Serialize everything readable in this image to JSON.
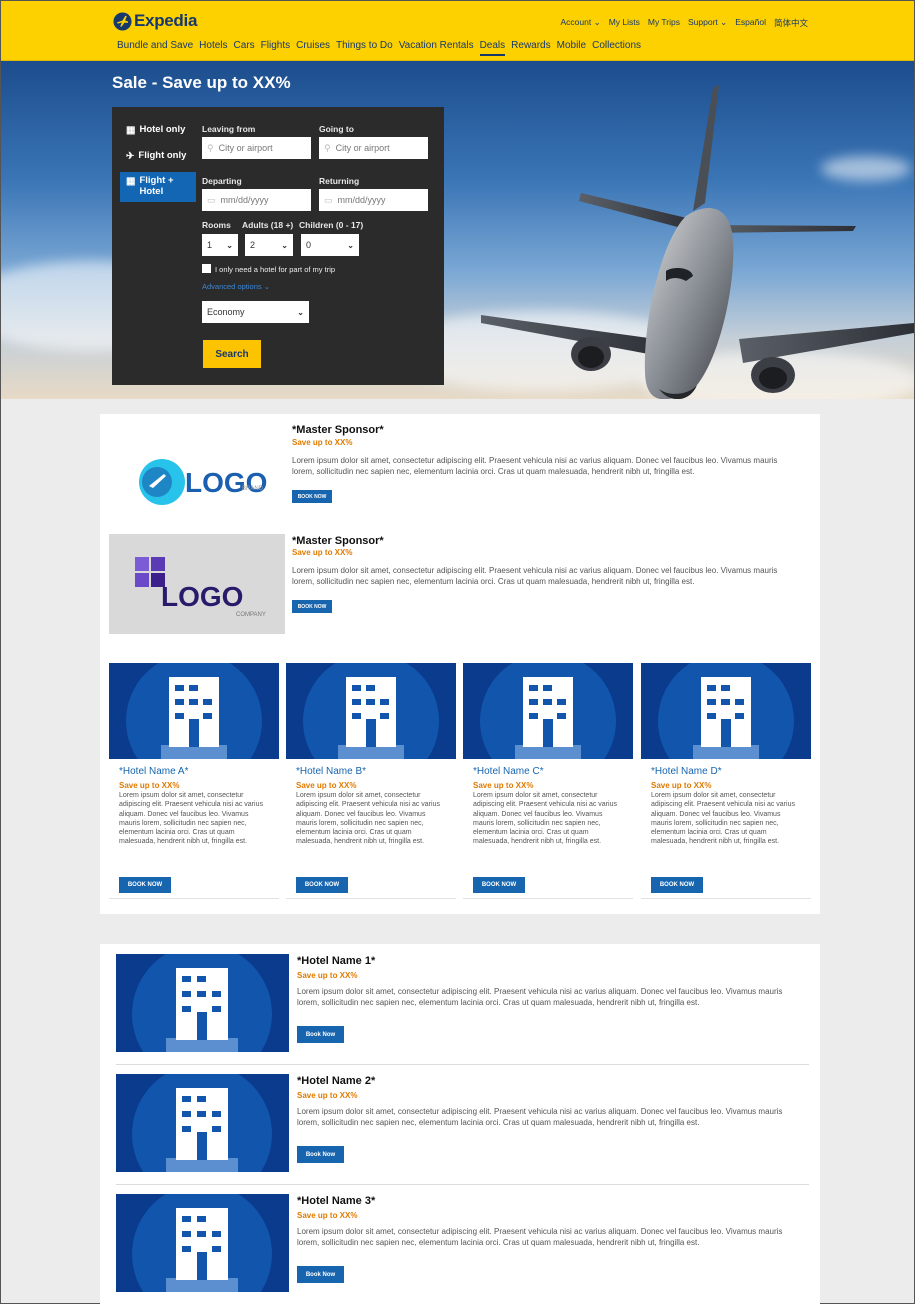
{
  "header": {
    "brand": "Expedia",
    "util_nav": [
      "Account ⌄",
      "My Lists",
      "My Trips",
      "Support ⌄",
      "Español",
      "简体中文"
    ],
    "main_nav": [
      "Bundle and Save",
      "Hotels",
      "Cars",
      "Flights",
      "Cruises",
      "Things to Do",
      "Vacation Rentals",
      "Deals",
      "Rewards",
      "Mobile",
      "Collections"
    ],
    "active_nav": "Deals"
  },
  "hero": {
    "title": "Sale - Save up to XX%"
  },
  "search": {
    "tabs": [
      {
        "label": "Hotel only",
        "icon": "hotel-icon"
      },
      {
        "label": "Flight only",
        "icon": "plane-icon"
      },
      {
        "label": "Flight + Hotel",
        "icon": "flight-hotel-icon"
      }
    ],
    "active_tab": "Flight + Hotel",
    "leaving_label": "Leaving from",
    "leaving_placeholder": "City or airport",
    "going_label": "Going to",
    "going_placeholder": "City or airport",
    "departing_label": "Departing",
    "departing_placeholder": "mm/dd/yyyy",
    "returning_label": "Returning",
    "returning_placeholder": "mm/dd/yyyy",
    "rooms_label": "Rooms",
    "rooms_value": "1",
    "adults_label": "Adults (18 +)",
    "adults_value": "2",
    "children_label": "Children (0 - 17)",
    "children_value": "0",
    "partial_hotel_label": "I only need a hotel for part of my trip",
    "advanced_label": "Advanced options ⌄",
    "class_value": "Economy",
    "search_label": "Search"
  },
  "sponsors": [
    {
      "title": "*Master Sponsor*",
      "save": "Save up to XX%",
      "text": "Lorem ipsum dolor sit amet, consectetur adipiscing elit. Praesent vehicula nisi ac varius aliquam. Donec vel faucibus leo. Vivamus mauris lorem, sollicitudin nec sapien nec, elementum lacinia orci. Cras ut quam malesuada, hendrerit nibh ut, fringilla est.",
      "button": "BOOK NOW",
      "logo_text": "LOGO",
      "logo_sub": "BRAND"
    },
    {
      "title": "*Master Sponsor*",
      "save": "Save up to XX%",
      "text": "Lorem ipsum dolor sit amet, consectetur adipiscing elit. Praesent vehicula nisi ac varius aliquam. Donec vel faucibus leo. Vivamus mauris lorem, sollicitudin nec sapien nec, elementum lacinia orci. Cras ut quam malesuada, hendrerit nibh ut, fringilla est.",
      "button": "BOOK NOW",
      "logo_text": "LOGO",
      "logo_sub": "COMPANY"
    }
  ],
  "hotel_cards": [
    {
      "title": "*Hotel Name A*",
      "save": "Save up to XX%",
      "text": "Lorem ipsum dolor sit amet, consectetur adipiscing elit. Praesent vehicula nisi ac varius aliquam. Donec vel faucibus leo. Vivamus mauris lorem, sollicitudin nec sapien nec, elementum lacinia orci. Cras ut quam malesuada, hendrerit nibh ut, fringilla est.",
      "button": "BOOK NOW"
    },
    {
      "title": "*Hotel Name B*",
      "save": "Save up to XX%",
      "text": "Lorem ipsum dolor sit amet, consectetur adipiscing elit. Praesent vehicula nisi ac varius aliquam. Donec vel faucibus leo. Vivamus mauris lorem, sollicitudin nec sapien nec, elementum lacinia orci. Cras ut quam malesuada, hendrerit nibh ut, fringilla est.",
      "button": "BOOK NOW"
    },
    {
      "title": "*Hotel Name C*",
      "save": "Save up to XX%",
      "text": "Lorem ipsum dolor sit amet, consectetur adipiscing elit. Praesent vehicula nisi ac varius aliquam. Donec vel faucibus leo. Vivamus mauris lorem, sollicitudin nec sapien nec, elementum lacinia orci. Cras ut quam malesuada, hendrerit nibh ut, fringilla est.",
      "button": "BOOK NOW"
    },
    {
      "title": "*Hotel Name D*",
      "save": "Save up to XX%",
      "text": "Lorem ipsum dolor sit amet, consectetur adipiscing elit. Praesent vehicula nisi ac varius aliquam. Donec vel faucibus leo. Vivamus mauris lorem, sollicitudin nec sapien nec, elementum lacinia orci. Cras ut quam malesuada, hendrerit nibh ut, fringilla est.",
      "button": "BOOK NOW"
    }
  ],
  "hotel_list": [
    {
      "title": "*Hotel Name 1*",
      "save": "Save up to XX%",
      "text": "Lorem ipsum dolor sit amet, consectetur adipiscing elit. Praesent vehicula nisi ac varius aliquam. Donec vel faucibus leo. Vivamus mauris lorem, sollicitudin nec sapien nec, elementum lacinia orci. Cras ut quam malesuada, hendrerit nibh ut, fringilla est.",
      "button": "Book Now"
    },
    {
      "title": "*Hotel Name 2*",
      "save": "Save up to XX%",
      "text": "Lorem ipsum dolor sit amet, consectetur adipiscing elit. Praesent vehicula nisi ac varius aliquam. Donec vel faucibus leo. Vivamus mauris lorem, sollicitudin nec sapien nec, elementum lacinia orci. Cras ut quam malesuada, hendrerit nibh ut, fringilla est.",
      "button": "Book Now"
    },
    {
      "title": "*Hotel Name 3*",
      "save": "Save up to XX%",
      "text": "Lorem ipsum dolor sit amet, consectetur adipiscing elit. Praesent vehicula nisi ac varius aliquam. Donec vel faucibus leo. Vivamus mauris lorem, sollicitudin nec sapien nec, elementum lacinia orci. Cras ut quam malesuada, hendrerit nibh ut, fringilla est.",
      "button": "Book Now"
    }
  ],
  "colors": {
    "header_bg": "#fdd000",
    "brand_navy": "#16386b",
    "button_blue": "#1765af",
    "save_orange": "#e07a00",
    "search_yellow": "#fcc300"
  }
}
